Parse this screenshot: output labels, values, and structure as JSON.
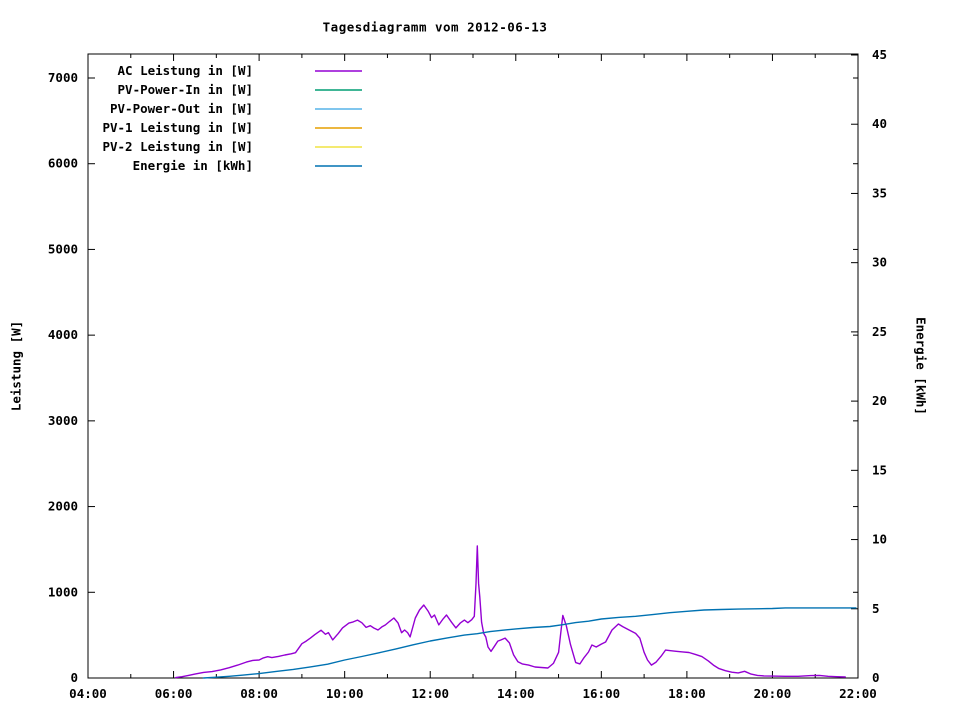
{
  "chart_data": {
    "type": "line",
    "title": "Tagesdiagramm vom 2012-06-13",
    "ylabel": "Leistung [W]",
    "y2label": "Energie [kWh]",
    "x_range_hours": [
      4,
      22
    ],
    "y_range": [
      0,
      7000
    ],
    "y2_range": [
      0,
      45
    ],
    "grid": false,
    "legend_position": "top-left-inside",
    "x_major_ticks": [
      {
        "h": 4,
        "label": "04:00"
      },
      {
        "h": 6,
        "label": "06:00"
      },
      {
        "h": 8,
        "label": "08:00"
      },
      {
        "h": 10,
        "label": "10:00"
      },
      {
        "h": 12,
        "label": "12:00"
      },
      {
        "h": 14,
        "label": "14:00"
      },
      {
        "h": 16,
        "label": "16:00"
      },
      {
        "h": 18,
        "label": "18:00"
      },
      {
        "h": 20,
        "label": "20:00"
      },
      {
        "h": 22,
        "label": "22:00"
      }
    ],
    "x_minor_hours": [
      5,
      7,
      9,
      11,
      13,
      15,
      17,
      19,
      21
    ],
    "y_ticks": [
      0,
      1000,
      2000,
      3000,
      4000,
      5000,
      6000,
      7000
    ],
    "y2_ticks": [
      0,
      5,
      10,
      15,
      20,
      25,
      30,
      35,
      40,
      45
    ],
    "series": [
      {
        "name": "AC Leistung in [W]",
        "color": "#9400d3",
        "axis": "y",
        "points": [
          [
            6.05,
            5
          ],
          [
            6.2,
            15
          ],
          [
            6.35,
            30
          ],
          [
            6.5,
            45
          ],
          [
            6.7,
            65
          ],
          [
            6.9,
            75
          ],
          [
            7.1,
            95
          ],
          [
            7.3,
            120
          ],
          [
            7.5,
            150
          ],
          [
            7.7,
            185
          ],
          [
            7.85,
            205
          ],
          [
            8.0,
            210
          ],
          [
            8.1,
            235
          ],
          [
            8.2,
            248
          ],
          [
            8.3,
            238
          ],
          [
            8.45,
            252
          ],
          [
            8.6,
            268
          ],
          [
            8.75,
            282
          ],
          [
            8.85,
            295
          ],
          [
            9.0,
            400
          ],
          [
            9.1,
            430
          ],
          [
            9.2,
            465
          ],
          [
            9.3,
            505
          ],
          [
            9.45,
            558
          ],
          [
            9.55,
            510
          ],
          [
            9.62,
            530
          ],
          [
            9.72,
            445
          ],
          [
            9.85,
            520
          ],
          [
            9.95,
            585
          ],
          [
            10.1,
            640
          ],
          [
            10.2,
            655
          ],
          [
            10.3,
            676
          ],
          [
            10.4,
            645
          ],
          [
            10.5,
            590
          ],
          [
            10.6,
            610
          ],
          [
            10.68,
            583
          ],
          [
            10.78,
            560
          ],
          [
            10.88,
            600
          ],
          [
            10.95,
            618
          ],
          [
            11.05,
            660
          ],
          [
            11.15,
            700
          ],
          [
            11.25,
            640
          ],
          [
            11.33,
            528
          ],
          [
            11.4,
            560
          ],
          [
            11.47,
            530
          ],
          [
            11.53,
            480
          ],
          [
            11.65,
            700
          ],
          [
            11.75,
            793
          ],
          [
            11.85,
            852
          ],
          [
            11.95,
            780
          ],
          [
            12.03,
            705
          ],
          [
            12.1,
            735
          ],
          [
            12.2,
            620
          ],
          [
            12.3,
            690
          ],
          [
            12.38,
            735
          ],
          [
            12.5,
            650
          ],
          [
            12.6,
            585
          ],
          [
            12.7,
            640
          ],
          [
            12.8,
            676
          ],
          [
            12.88,
            645
          ],
          [
            12.97,
            680
          ],
          [
            13.03,
            720
          ],
          [
            13.07,
            1100
          ],
          [
            13.1,
            1540
          ],
          [
            13.13,
            1100
          ],
          [
            13.16,
            945
          ],
          [
            13.2,
            650
          ],
          [
            13.25,
            520
          ],
          [
            13.3,
            478
          ],
          [
            13.35,
            362
          ],
          [
            13.42,
            310
          ],
          [
            13.5,
            370
          ],
          [
            13.58,
            430
          ],
          [
            13.65,
            443
          ],
          [
            13.75,
            465
          ],
          [
            13.85,
            410
          ],
          [
            13.95,
            270
          ],
          [
            14.05,
            190
          ],
          [
            14.15,
            165
          ],
          [
            14.3,
            150
          ],
          [
            14.45,
            128
          ],
          [
            14.6,
            122
          ],
          [
            14.75,
            117
          ],
          [
            14.88,
            170
          ],
          [
            15.0,
            300
          ],
          [
            15.05,
            520
          ],
          [
            15.1,
            730
          ],
          [
            15.18,
            610
          ],
          [
            15.28,
            390
          ],
          [
            15.4,
            180
          ],
          [
            15.5,
            165
          ],
          [
            15.6,
            240
          ],
          [
            15.7,
            303
          ],
          [
            15.78,
            385
          ],
          [
            15.88,
            362
          ],
          [
            16.0,
            395
          ],
          [
            16.1,
            420
          ],
          [
            16.25,
            560
          ],
          [
            16.4,
            630
          ],
          [
            16.5,
            600
          ],
          [
            16.65,
            560
          ],
          [
            16.8,
            520
          ],
          [
            16.9,
            466
          ],
          [
            17.0,
            300
          ],
          [
            17.08,
            210
          ],
          [
            17.17,
            150
          ],
          [
            17.28,
            185
          ],
          [
            17.4,
            255
          ],
          [
            17.5,
            325
          ],
          [
            17.62,
            318
          ],
          [
            17.75,
            312
          ],
          [
            17.9,
            305
          ],
          [
            18.05,
            298
          ],
          [
            18.2,
            275
          ],
          [
            18.35,
            250
          ],
          [
            18.5,
            200
          ],
          [
            18.62,
            150
          ],
          [
            18.75,
            110
          ],
          [
            18.9,
            85
          ],
          [
            19.05,
            68
          ],
          [
            19.2,
            60
          ],
          [
            19.35,
            78
          ],
          [
            19.5,
            45
          ],
          [
            19.65,
            30
          ],
          [
            19.8,
            24
          ],
          [
            20.0,
            22
          ],
          [
            20.3,
            20
          ],
          [
            20.6,
            20
          ],
          [
            20.9,
            28
          ],
          [
            21.1,
            30
          ],
          [
            21.3,
            20
          ],
          [
            21.5,
            15
          ],
          [
            21.7,
            12
          ]
        ]
      },
      {
        "name": "PV-Power-In in [W]",
        "color": "#009e73",
        "axis": "y",
        "points": []
      },
      {
        "name": "PV-Power-Out in [W]",
        "color": "#56b4e9",
        "axis": "y",
        "points": []
      },
      {
        "name": "PV-1 Leistung in [W]",
        "color": "#e69f00",
        "axis": "y",
        "points": []
      },
      {
        "name": "PV-2 Leistung in [W]",
        "color": "#f0e442",
        "axis": "y",
        "points": []
      },
      {
        "name": "Energie in [kWh]",
        "color": "#0072b2",
        "axis": "y2",
        "points": [
          [
            6.7,
            0.0
          ],
          [
            7.0,
            0.06
          ],
          [
            7.3,
            0.12
          ],
          [
            7.6,
            0.2
          ],
          [
            8.0,
            0.32
          ],
          [
            8.4,
            0.48
          ],
          [
            8.8,
            0.62
          ],
          [
            9.2,
            0.8
          ],
          [
            9.6,
            1.0
          ],
          [
            10.0,
            1.3
          ],
          [
            10.4,
            1.55
          ],
          [
            10.8,
            1.82
          ],
          [
            11.2,
            2.1
          ],
          [
            11.6,
            2.4
          ],
          [
            12.0,
            2.67
          ],
          [
            12.4,
            2.9
          ],
          [
            12.8,
            3.1
          ],
          [
            13.1,
            3.2
          ],
          [
            13.4,
            3.35
          ],
          [
            13.7,
            3.45
          ],
          [
            14.0,
            3.55
          ],
          [
            14.4,
            3.65
          ],
          [
            14.8,
            3.72
          ],
          [
            15.1,
            3.85
          ],
          [
            15.4,
            4.0
          ],
          [
            15.7,
            4.1
          ],
          [
            16.0,
            4.26
          ],
          [
            16.4,
            4.38
          ],
          [
            16.8,
            4.46
          ],
          [
            17.2,
            4.58
          ],
          [
            17.6,
            4.72
          ],
          [
            18.0,
            4.82
          ],
          [
            18.4,
            4.91
          ],
          [
            18.8,
            4.95
          ],
          [
            19.2,
            4.98
          ],
          [
            19.6,
            5.0
          ],
          [
            20.0,
            5.02
          ],
          [
            20.3,
            5.06
          ],
          [
            21.0,
            5.06
          ],
          [
            21.5,
            5.06
          ],
          [
            21.95,
            5.06
          ]
        ]
      }
    ]
  }
}
